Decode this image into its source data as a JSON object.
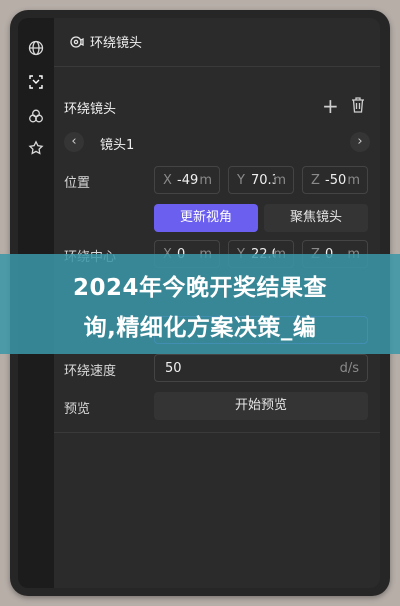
{
  "header": {
    "title": "环绕镜头"
  },
  "section": {
    "title": "环绕镜头"
  },
  "shot": {
    "name": "镜头1",
    "prev": "‹",
    "next": "›"
  },
  "position": {
    "label": "位置",
    "x": {
      "axis": "X",
      "value": "-49",
      "unit": "m"
    },
    "y": {
      "axis": "Y",
      "value": "70.3",
      "unit": "m"
    },
    "z": {
      "axis": "Z",
      "value": "-50",
      "unit": "m"
    }
  },
  "buttons": {
    "update_view": "更新视角",
    "focus_shot": "聚焦镜头",
    "start_preview": "开始预览"
  },
  "center": {
    "label": "环绕中心",
    "x": {
      "axis": "X",
      "value": "0",
      "unit": "m"
    },
    "y": {
      "axis": "Y",
      "value": "22.0",
      "unit": "m"
    },
    "z": {
      "axis": "Z",
      "value": "0",
      "unit": "m"
    }
  },
  "speed": {
    "label": "环绕速度",
    "value": "50",
    "unit": "d/s"
  },
  "preview": {
    "label": "预览"
  },
  "banner": {
    "line1": "2024年今晚开奖结果查",
    "line2": "询,精细化方案决策_编"
  },
  "colors": {
    "accent": "#6b5ff0",
    "banner": "#3a96a8",
    "panel": "#2b2b2b"
  }
}
